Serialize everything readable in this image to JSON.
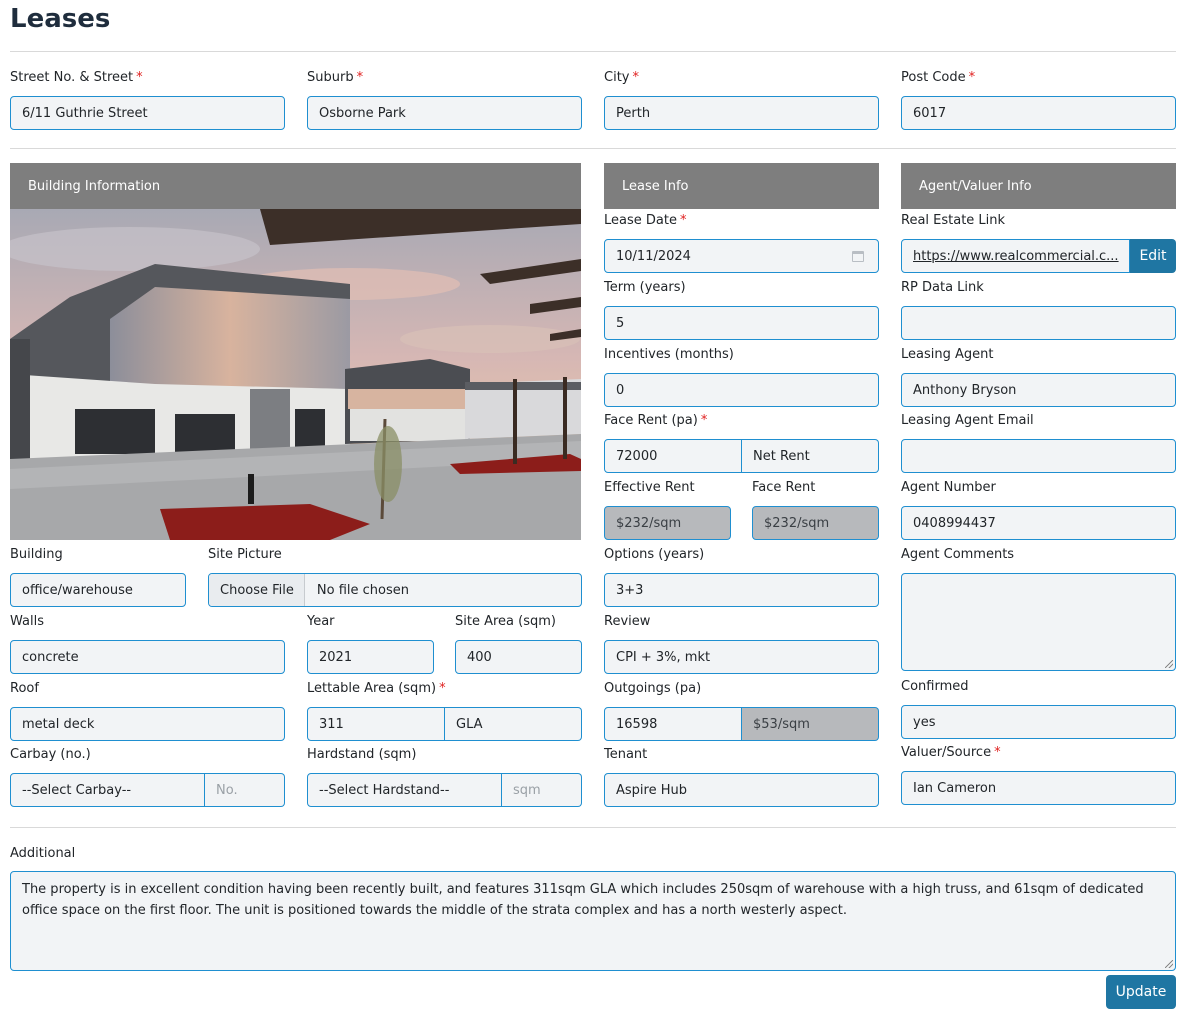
{
  "page": {
    "title": "Leases"
  },
  "address": {
    "street": {
      "label": "Street No. & Street",
      "value": "6/11 Guthrie Street"
    },
    "suburb": {
      "label": "Suburb",
      "value": "Osborne Park"
    },
    "city": {
      "label": "City",
      "value": "Perth"
    },
    "postcode": {
      "label": "Post Code",
      "value": "6017"
    }
  },
  "building": {
    "header": "Building Information",
    "type": {
      "label": "Building",
      "value": "office/warehouse"
    },
    "site_picture": {
      "label": "Site Picture",
      "button": "Choose File",
      "status": "No file chosen"
    },
    "walls": {
      "label": "Walls",
      "value": "concrete"
    },
    "year": {
      "label": "Year",
      "value": "2021"
    },
    "site_area": {
      "label": "Site Area (sqm)",
      "value": "400"
    },
    "roof": {
      "label": "Roof",
      "value": "metal deck"
    },
    "lettable_area": {
      "label": "Lettable Area (sqm)",
      "value": "311",
      "unit": "GLA"
    },
    "carbay": {
      "label": "Carbay (no.)",
      "value": "--Select Carbay--",
      "placeholder": "No."
    },
    "hardstand": {
      "label": "Hardstand (sqm)",
      "value": "--Select Hardstand--",
      "placeholder": "sqm"
    }
  },
  "lease": {
    "header": "Lease Info",
    "date": {
      "label": "Lease Date",
      "value": "10/11/2024"
    },
    "term": {
      "label": "Term (years)",
      "value": "5"
    },
    "incentives": {
      "label": "Incentives (months)",
      "value": "0"
    },
    "face_rent": {
      "label": "Face Rent (pa)",
      "value": "72000",
      "type": "Net Rent"
    },
    "effective_rent": {
      "label": "Effective Rent",
      "value": "$232/sqm"
    },
    "face_rent_sqm": {
      "label": "Face Rent",
      "value": "$232/sqm"
    },
    "options": {
      "label": "Options (years)",
      "value": "3+3"
    },
    "review": {
      "label": "Review",
      "value": "CPI + 3%, mkt"
    },
    "outgoings": {
      "label": "Outgoings (pa)",
      "value": "16598",
      "per_sqm": "$53/sqm"
    },
    "tenant": {
      "label": "Tenant",
      "value": "Aspire Hub"
    }
  },
  "agent": {
    "header": "Agent/Valuer Info",
    "real_estate_link": {
      "label": "Real Estate Link",
      "value": "https://www.realcommercial.c...",
      "edit": "Edit"
    },
    "rp_data_link": {
      "label": "RP Data Link",
      "value": ""
    },
    "leasing_agent": {
      "label": "Leasing Agent",
      "value": "Anthony Bryson"
    },
    "leasing_agent_email": {
      "label": "Leasing Agent Email",
      "value": ""
    },
    "agent_number": {
      "label": "Agent Number",
      "value": "0408994437"
    },
    "comments": {
      "label": "Agent Comments",
      "value": ""
    },
    "confirmed": {
      "label": "Confirmed",
      "value": "yes"
    },
    "valuer": {
      "label": "Valuer/Source",
      "value": "Ian Cameron"
    }
  },
  "additional": {
    "label": "Additional",
    "value": "The property is in excellent condition having been recently built, and features 311sqm GLA which includes 250sqm of warehouse with a high truss, and 61sqm of dedicated office space on the first floor. The unit is positioned towards the middle of the strata complex and has a north westerly aspect."
  },
  "actions": {
    "update": "Update"
  },
  "colors": {
    "accent": "#1f76a3",
    "input_border": "#1f8fd0",
    "panel_header": "#7e7e7e",
    "required": "#e0201f"
  }
}
